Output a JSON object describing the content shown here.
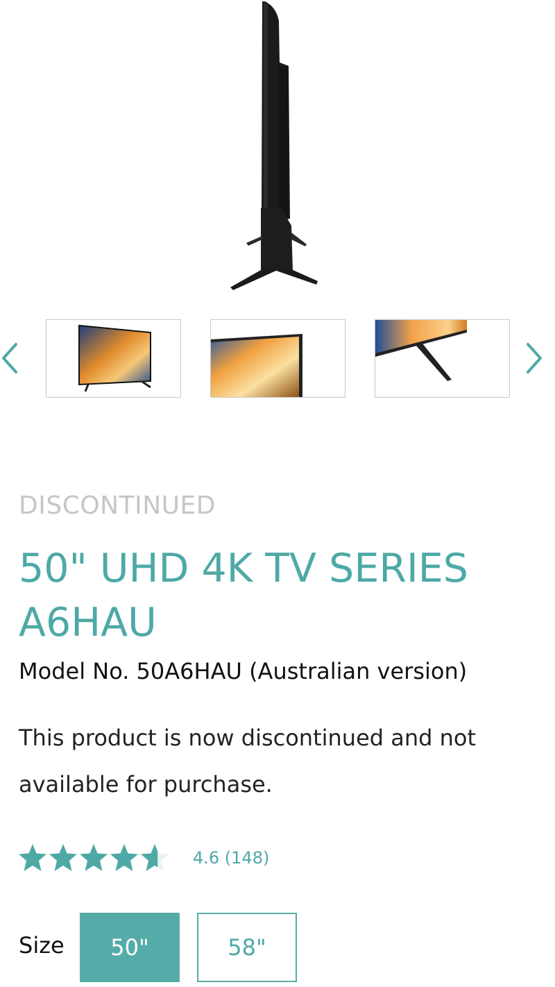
{
  "gallery": {
    "main_image": "tv-side-view",
    "thumbnails": [
      {
        "name": "tv-front-view"
      },
      {
        "name": "tv-corner-closeup"
      },
      {
        "name": "tv-stand-closeup"
      }
    ],
    "prev_icon": "chevron-left-icon",
    "next_icon": "chevron-right-icon"
  },
  "product": {
    "status": "DISCONTINUED",
    "title": "50\" UHD 4K TV SERIES A6HAU",
    "model": "Model No. 50A6HAU (Australian version)",
    "notice": "This product is now discontinued and not available for purchase.",
    "rating": {
      "value": 4.6,
      "max": 5,
      "text": "4.6 (148)"
    }
  },
  "size": {
    "label": "Size",
    "options": [
      {
        "label": "50\"",
        "selected": true
      },
      {
        "label": "58\"",
        "selected": false
      }
    ]
  },
  "colors": {
    "accent": "#4ea9a6",
    "accent_fill": "#55aba8",
    "muted": "#c6c6c6"
  }
}
